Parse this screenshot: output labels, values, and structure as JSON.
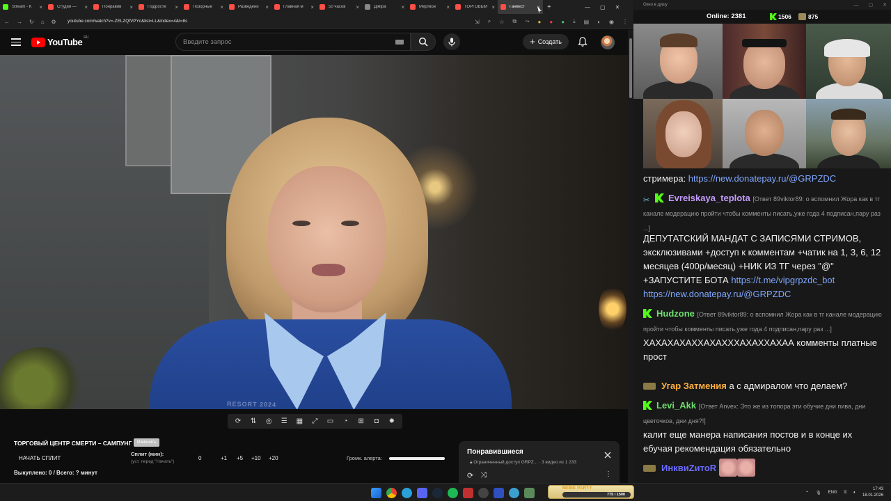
{
  "browser": {
    "tabs": [
      {
        "label": "Stream - K",
        "color": "#53fc18",
        "active": false
      },
      {
        "label": "Студия —",
        "color": "#ff4e45",
        "active": false
      },
      {
        "label": "Понравив",
        "color": "#ff4e45",
        "active": false
      },
      {
        "label": "Подросте",
        "color": "#ff4e45",
        "active": false
      },
      {
        "label": "Позорные",
        "color": "#ff4e45",
        "active": false
      },
      {
        "label": "Разведени",
        "color": "#ff4e45",
        "active": false
      },
      {
        "label": "Главная м",
        "color": "#ff4e45",
        "active": false
      },
      {
        "label": "50 часов",
        "color": "#ff4e45",
        "active": false
      },
      {
        "label": "Дiмlра",
        "color": "#888888",
        "active": false
      },
      {
        "label": "Мертвое",
        "color": "#ff4e45",
        "active": false
      },
      {
        "label": "ТОРГОВЫЙ",
        "color": "#ff4e45",
        "active": false
      },
      {
        "label": "Ганвест",
        "color": "#ff4e45",
        "active": true
      }
    ],
    "url": "youtube.com/watch?v=-ZELZQfVPYc&list=LL&index=4&t=8s"
  },
  "youtube": {
    "logo_text": "YouTube",
    "region": "RU",
    "search_placeholder": "Введите запрос",
    "create_label": "Создать"
  },
  "video": {
    "shirt_text": "RESORT 2024"
  },
  "controls": {
    "game_title": "ТОРГОВЫЙ ЦЕНТР СМЕРТИ – САМПУНГ",
    "choose_label": "Изменить",
    "start_split": "НАЧАТЬ СПЛИТ",
    "split_label": "Сплит (мин):",
    "split_hint": "(уст. перед \"Начать\")",
    "split_value": "0",
    "increments": [
      "+1",
      "+5",
      "+10",
      "+20"
    ],
    "alert_volume_label": "Громк. алерта:",
    "alert_volume": 1.0,
    "bought": "Выкуплено: 0 / Всего: ? минут"
  },
  "liked_panel": {
    "title": "Понравившиеся",
    "subtitle": "Ограниченный доступ  GRPZ...  ·  3 видео из 1 233"
  },
  "overlay": {
    "window_title": "Окно в душу",
    "online_label": "Online: 2381",
    "kick_count": "1506",
    "twitch_count": "875"
  },
  "chat": {
    "messages": [
      {
        "type": "text",
        "text": "стримера: ",
        "link": "https://new.donatepay.ru/@GRPZDC"
      },
      {
        "user": "Evreiskaya_teplota",
        "user_color": "#c59cff",
        "badge": "sword",
        "reply": "[Ответ 89viktor89: о вспомнил Жора как в тг канале модерацию пройти чтобы комменты писать,уже года 4 подписан,пару раз ...]",
        "text": ""
      },
      {
        "type": "text",
        "text": "ДЕПУТАТСКИЙ МАНДАТ С ЗАПИСЯМИ СТРИМОВ, эксклюзивами +доступ к комментам +чатик на 1, 3, 6, 12 месяцев (400р/месяц) +НИК ИЗ ТГ через \"@\" +ЗАПУСТИТЕ БОТА ",
        "link": "https://t.me/vipgrpzdc_bot",
        "link2": "https://new.donatepay.ru/@GRPZDC"
      },
      {
        "user": "Hudzone",
        "user_color": "#6ee06e",
        "badge": "k",
        "reply": "[Ответ 89viktor89: о вспомнил Жора как в тг канале модерацию пройти чтобы комменты писать,уже года 4 подписан,пару раз ...]",
        "text": "ХАХАХАХАХХАХАХХХАХАХХАХАА комменты платные прост"
      },
      {
        "user": "Угар Затмения",
        "user_color": "#ffb040",
        "badge": "hat",
        "text": "а с адмиралом что делаем?"
      },
      {
        "user": "Levi_Akk",
        "user_color": "#6ee06e",
        "badge": "k",
        "reply": "[Ответ Anvex: Это же из топора эти обучие дни пива, дни цветочков, дни дня?!]",
        "text": "калит еще манера написания постов и в конце их ебучая рекомендация обязательно"
      },
      {
        "user": "ИнквиZитоR",
        "user_color": "#6b6bff",
        "badge": "hat",
        "text": ""
      }
    ]
  },
  "taskbar": {
    "meme_label": "MEME PARTY",
    "meme_value": "775 / 1500",
    "lang": "ENG",
    "time": "17:43",
    "date": "18.01.2026"
  },
  "colors": {
    "accent": "#ff0000",
    "kick": "#53fc18",
    "link": "#7fa7ff"
  }
}
